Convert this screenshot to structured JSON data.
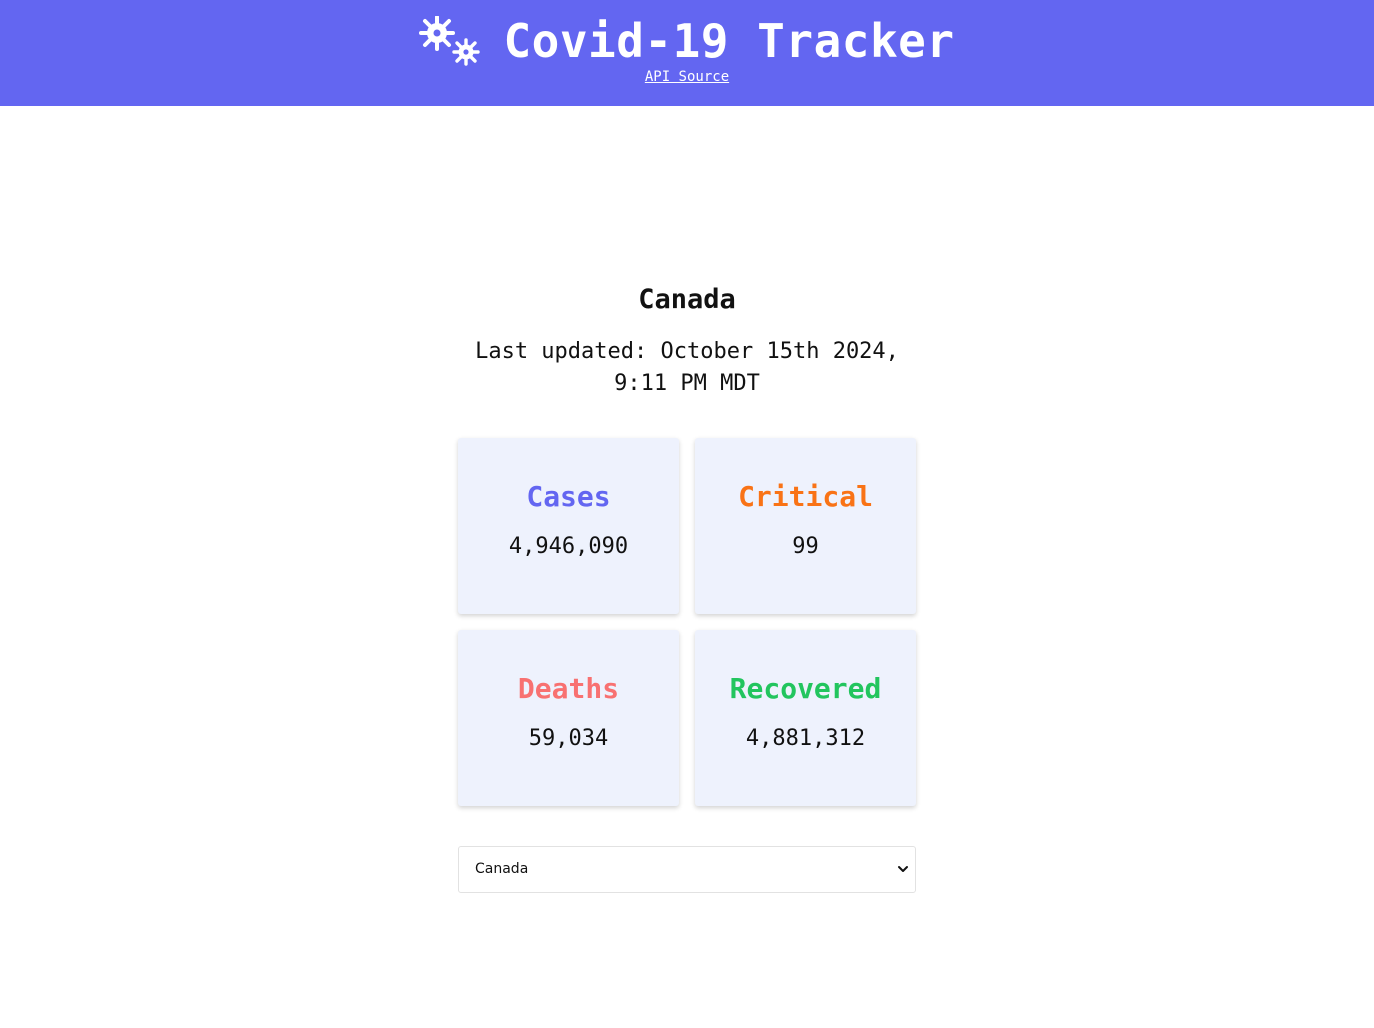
{
  "header": {
    "title": "Covid-19 Tracker",
    "api_link": "API Source",
    "logo_icon": "virus-icon",
    "background": "#6366f1"
  },
  "main": {
    "country": "Canada",
    "last_updated": "Last updated: October 15th 2024, 9:11 PM MDT"
  },
  "stats": [
    {
      "label": "Cases",
      "value": "4,946,090",
      "color": "#6366f1"
    },
    {
      "label": "Critical",
      "value": "99",
      "color": "#f97316"
    },
    {
      "label": "Deaths",
      "value": "59,034",
      "color": "#f87171"
    },
    {
      "label": "Recovered",
      "value": "4,881,312",
      "color": "#22c55e"
    }
  ],
  "country_select": {
    "selected": "Canada",
    "chevron_icon": "chevron-down-icon"
  }
}
